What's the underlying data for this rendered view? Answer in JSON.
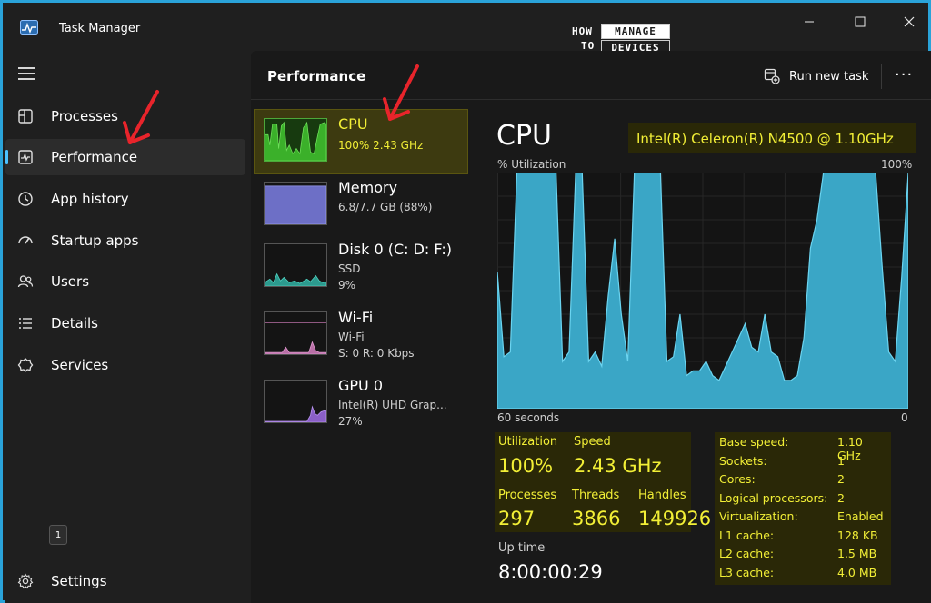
{
  "window": {
    "title": "Task Manager"
  },
  "logo": {
    "how": "HOW",
    "to": "TO",
    "manage": "MANAGE",
    "devices": "DEVICES"
  },
  "sidebar": {
    "items": [
      {
        "label": "Processes",
        "icon": "processes-icon"
      },
      {
        "label": "Performance",
        "icon": "performance-icon",
        "active": true
      },
      {
        "label": "App history",
        "icon": "app-history-icon"
      },
      {
        "label": "Startup apps",
        "icon": "startup-apps-icon"
      },
      {
        "label": "Users",
        "icon": "users-icon"
      },
      {
        "label": "Details",
        "icon": "details-icon"
      },
      {
        "label": "Services",
        "icon": "services-icon"
      }
    ],
    "badge": "1",
    "settings_label": "Settings"
  },
  "header": {
    "title": "Performance",
    "run_new_task": "Run new task"
  },
  "resources": [
    {
      "name": "CPU",
      "line1": "100%  2.43 GHz",
      "selected": true
    },
    {
      "name": "Memory",
      "line1": "6.8/7.7 GB (88%)"
    },
    {
      "name": "Disk 0 (C: D: F:)",
      "line1": "SSD",
      "line2": "9%"
    },
    {
      "name": "Wi-Fi",
      "line1": "Wi-Fi",
      "line2": "S: 0 R: 0 Kbps"
    },
    {
      "name": "GPU 0",
      "line1": "Intel(R) UHD Grap...",
      "line2": "27%"
    }
  ],
  "cpu": {
    "title": "CPU",
    "model": "Intel(R) Celeron(R) N4500 @ 1.10GHz",
    "util_label": "% Utilization",
    "util_max": "100%",
    "axis_left": "60 seconds",
    "axis_right": "0",
    "graph_values": [
      58,
      22,
      24,
      100,
      100,
      100,
      100,
      100,
      100,
      100,
      20,
      24,
      100,
      100,
      20,
      24,
      18,
      48,
      72,
      40,
      20,
      100,
      100,
      100,
      100,
      100,
      20,
      22,
      40,
      14,
      16,
      16,
      20,
      14,
      12,
      18,
      24,
      30,
      36,
      26,
      24,
      40,
      24,
      22,
      12,
      12,
      14,
      30,
      68,
      80,
      100,
      100,
      100,
      100,
      100,
      100,
      100,
      100,
      100,
      60,
      24,
      20,
      56,
      100
    ],
    "stats": {
      "utilization_label": "Utilization",
      "utilization": "100%",
      "speed_label": "Speed",
      "speed": "2.43 GHz",
      "processes_label": "Processes",
      "processes": "297",
      "threads_label": "Threads",
      "threads": "3866",
      "handles_label": "Handles",
      "handles": "149926",
      "uptime_label": "Up time",
      "uptime": "8:00:00:29"
    },
    "specs": [
      {
        "k": "Base speed:",
        "v": "1.10 GHz"
      },
      {
        "k": "Sockets:",
        "v": "1"
      },
      {
        "k": "Cores:",
        "v": "2"
      },
      {
        "k": "Logical processors:",
        "v": "2"
      },
      {
        "k": "Virtualization:",
        "v": "Enabled"
      },
      {
        "k": "L1 cache:",
        "v": "128 KB"
      },
      {
        "k": "L2 cache:",
        "v": "1.5 MB"
      },
      {
        "k": "L3 cache:",
        "v": "4.0 MB"
      }
    ]
  },
  "colors": {
    "accent": "#4cc2ff",
    "highlight": "#f2ef36",
    "graph_fill": "#3aa6c6",
    "graph_line": "#6bd4f0",
    "annotation_arrow": "#e8242b",
    "cpu_thumb": "#3bb02a",
    "memory_thumb": "#6d6fc6",
    "disk_thumb": "#2c9a8e",
    "wifi_thumb": "#b86fa6",
    "gpu_thumb": "#8a5fc6"
  }
}
